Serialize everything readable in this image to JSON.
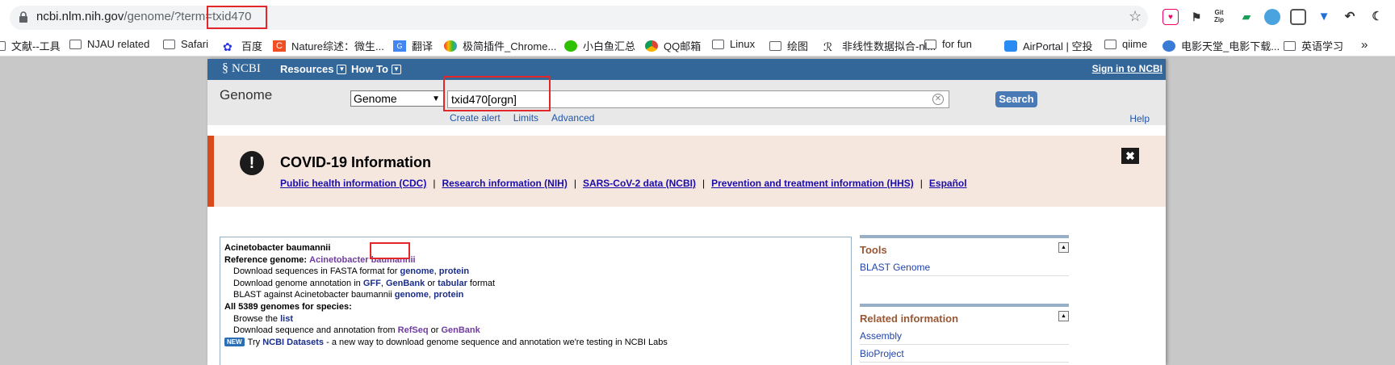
{
  "browser": {
    "url_host": "ncbi.nlm.nih.gov",
    "url_path": "/genome/?term=",
    "url_query": "txid470",
    "bookmarks": [
      "文献--工具",
      "NJAU related",
      "Safari",
      "百度",
      "Nature综述：微生...",
      "翻译",
      "极简插件_Chrome...",
      "小白鱼汇总",
      "QQ邮箱",
      "Linux",
      "绘图",
      "非线性数据拟合-nl...",
      "for fun",
      "AirPortal | 空投",
      "qiime",
      "电影天堂_电影下载...",
      "英语学习"
    ],
    "more": "»"
  },
  "ncbi": {
    "logo": "NCBI",
    "resources": "Resources",
    "howto": "How To",
    "signin": "Sign in to NCBI"
  },
  "search": {
    "db_title": "Genome",
    "db_selected": "Genome",
    "term": "txid470[orgn]",
    "button": "Search",
    "create_alert": "Create alert",
    "limits": "Limits",
    "advanced": "Advanced",
    "help": "Help"
  },
  "covid": {
    "title": "COVID-19 Information",
    "links": [
      "Public health information (CDC)",
      "Research information (NIH)",
      "SARS-CoV-2 data (NCBI)",
      "Prevention and treatment information (HHS)",
      "Español"
    ],
    "sep": "|"
  },
  "result": {
    "organism": "Acinetobacter baumannii",
    "ref_label": "Reference genome:",
    "ref_name": "Acinetobacter baumannii",
    "fasta_text": "Download sequences in FASTA format for",
    "fasta_genome": "genome",
    "fasta_protein": "protein",
    "annot_text": "Download genome annotation in",
    "annot_gff": "GFF",
    "annot_genbank": "GenBank",
    "annot_or": "or",
    "annot_tabular": "tabular",
    "annot_format": "format",
    "blast_text": "BLAST against Acinetobacter baumannii",
    "blast_genome": "genome",
    "blast_protein": "protein",
    "all_genomes": "All 5389 genomes for species:",
    "browse_text": "Browse the",
    "browse_list": "list",
    "dl_text": "Download sequence and annotation from",
    "dl_refseq": "RefSeq",
    "dl_or": "or",
    "dl_genbank": "GenBank",
    "new_badge": "NEW",
    "try_text": "Try",
    "datasets": "NCBI Datasets",
    "datasets_desc": "- a new way to download genome sequence and annotation we're testing in NCBI Labs"
  },
  "sidebar": {
    "tools_title": "Tools",
    "tools_items": [
      "BLAST Genome"
    ],
    "related_title": "Related information",
    "related_items": [
      "Assembly",
      "BioProject"
    ]
  },
  "colors": {
    "ncbi_blue": "#336699",
    "highlight_red": "#e3262a",
    "covid_bg": "#f5e6de",
    "covid_accent": "#d84a1b"
  }
}
